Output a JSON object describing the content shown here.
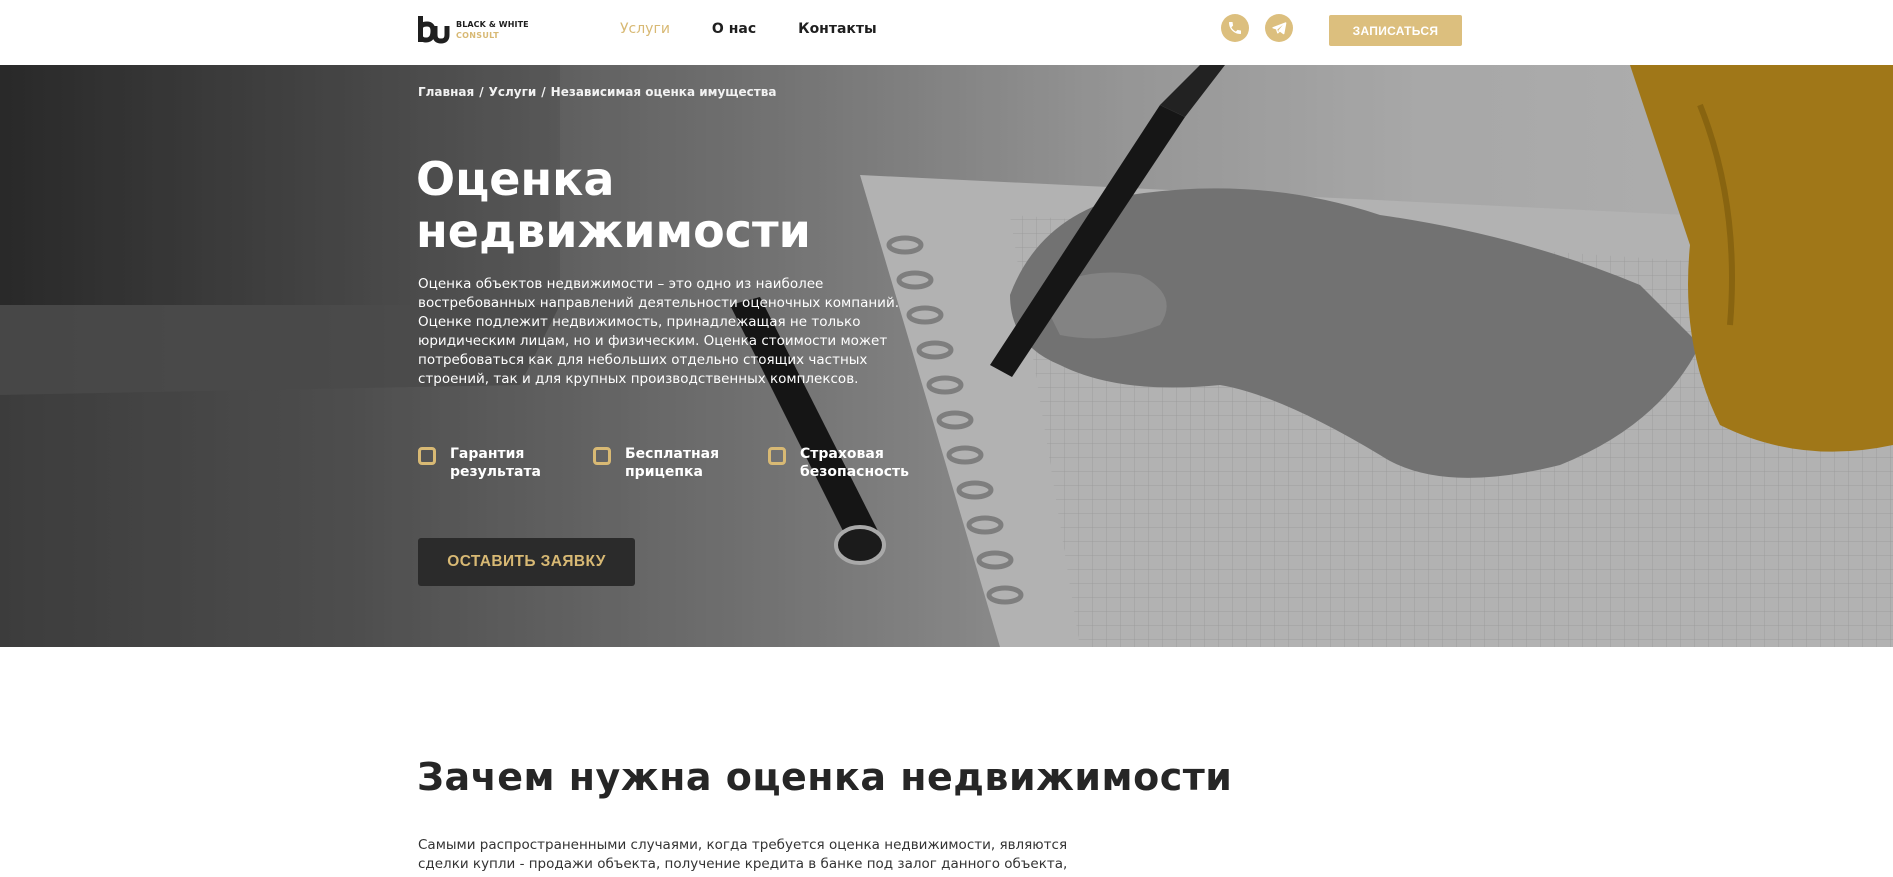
{
  "logo": {
    "line1": "BLACK & WHITE",
    "line2": "CONSULT"
  },
  "nav": {
    "items": [
      {
        "label": "Услуги",
        "active": true
      },
      {
        "label": "О нас",
        "active": false
      },
      {
        "label": "Контакты",
        "active": false
      }
    ]
  },
  "header": {
    "signup_label": "ЗАПИСАТЬСЯ"
  },
  "hero": {
    "breadcrumb": [
      "Главная",
      "Услуги",
      "Независимая оценка имущества"
    ],
    "breadcrumb_separator": "/",
    "title_line1": "Оценка",
    "title_line2": "недвижимости",
    "description": "Оценка объектов недвижимости – это одно из наиболее востребованных направлений деятельности оценочных компаний. Оценке подлежит недвижимость, принадлежащая не только юридическим лицам, но и физическим. Оценка стоимости может потребоваться как для небольших отдельно стоящих частных строений, так и для крупных производственных комплексов.",
    "features": [
      {
        "label": "Гарантия результата"
      },
      {
        "label": "Бесплатная прицепка"
      },
      {
        "label": "Страховая безопасность"
      }
    ],
    "apply_label": "ОСТАВИТЬ ЗАЯВКУ"
  },
  "section": {
    "title": "Зачем нужна оценка недвижимости",
    "text": "Самыми распространенными случаями, когда требуется оценка недвижимости, являются сделки купли - продажи объекта, получение кредита в банке под залог данного объекта,"
  },
  "colors": {
    "accent": "#d8b974",
    "dark": "#2b2b2b",
    "text": "#1f1f1f"
  },
  "icons": {
    "phone": "phone-icon",
    "telegram": "telegram-icon",
    "feature": "square-outline-icon"
  }
}
